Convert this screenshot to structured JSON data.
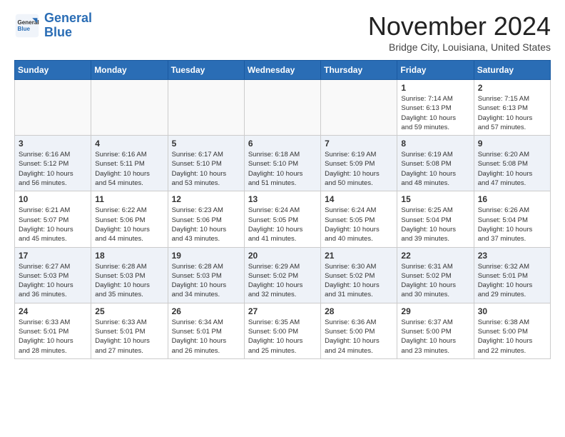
{
  "header": {
    "logo_line1": "General",
    "logo_line2": "Blue",
    "month": "November 2024",
    "location": "Bridge City, Louisiana, United States"
  },
  "days_of_week": [
    "Sunday",
    "Monday",
    "Tuesday",
    "Wednesday",
    "Thursday",
    "Friday",
    "Saturday"
  ],
  "weeks": [
    [
      {
        "day": "",
        "info": ""
      },
      {
        "day": "",
        "info": ""
      },
      {
        "day": "",
        "info": ""
      },
      {
        "day": "",
        "info": ""
      },
      {
        "day": "",
        "info": ""
      },
      {
        "day": "1",
        "info": "Sunrise: 7:14 AM\nSunset: 6:13 PM\nDaylight: 10 hours\nand 59 minutes."
      },
      {
        "day": "2",
        "info": "Sunrise: 7:15 AM\nSunset: 6:13 PM\nDaylight: 10 hours\nand 57 minutes."
      }
    ],
    [
      {
        "day": "3",
        "info": "Sunrise: 6:16 AM\nSunset: 5:12 PM\nDaylight: 10 hours\nand 56 minutes."
      },
      {
        "day": "4",
        "info": "Sunrise: 6:16 AM\nSunset: 5:11 PM\nDaylight: 10 hours\nand 54 minutes."
      },
      {
        "day": "5",
        "info": "Sunrise: 6:17 AM\nSunset: 5:10 PM\nDaylight: 10 hours\nand 53 minutes."
      },
      {
        "day": "6",
        "info": "Sunrise: 6:18 AM\nSunset: 5:10 PM\nDaylight: 10 hours\nand 51 minutes."
      },
      {
        "day": "7",
        "info": "Sunrise: 6:19 AM\nSunset: 5:09 PM\nDaylight: 10 hours\nand 50 minutes."
      },
      {
        "day": "8",
        "info": "Sunrise: 6:19 AM\nSunset: 5:08 PM\nDaylight: 10 hours\nand 48 minutes."
      },
      {
        "day": "9",
        "info": "Sunrise: 6:20 AM\nSunset: 5:08 PM\nDaylight: 10 hours\nand 47 minutes."
      }
    ],
    [
      {
        "day": "10",
        "info": "Sunrise: 6:21 AM\nSunset: 5:07 PM\nDaylight: 10 hours\nand 45 minutes."
      },
      {
        "day": "11",
        "info": "Sunrise: 6:22 AM\nSunset: 5:06 PM\nDaylight: 10 hours\nand 44 minutes."
      },
      {
        "day": "12",
        "info": "Sunrise: 6:23 AM\nSunset: 5:06 PM\nDaylight: 10 hours\nand 43 minutes."
      },
      {
        "day": "13",
        "info": "Sunrise: 6:24 AM\nSunset: 5:05 PM\nDaylight: 10 hours\nand 41 minutes."
      },
      {
        "day": "14",
        "info": "Sunrise: 6:24 AM\nSunset: 5:05 PM\nDaylight: 10 hours\nand 40 minutes."
      },
      {
        "day": "15",
        "info": "Sunrise: 6:25 AM\nSunset: 5:04 PM\nDaylight: 10 hours\nand 39 minutes."
      },
      {
        "day": "16",
        "info": "Sunrise: 6:26 AM\nSunset: 5:04 PM\nDaylight: 10 hours\nand 37 minutes."
      }
    ],
    [
      {
        "day": "17",
        "info": "Sunrise: 6:27 AM\nSunset: 5:03 PM\nDaylight: 10 hours\nand 36 minutes."
      },
      {
        "day": "18",
        "info": "Sunrise: 6:28 AM\nSunset: 5:03 PM\nDaylight: 10 hours\nand 35 minutes."
      },
      {
        "day": "19",
        "info": "Sunrise: 6:28 AM\nSunset: 5:03 PM\nDaylight: 10 hours\nand 34 minutes."
      },
      {
        "day": "20",
        "info": "Sunrise: 6:29 AM\nSunset: 5:02 PM\nDaylight: 10 hours\nand 32 minutes."
      },
      {
        "day": "21",
        "info": "Sunrise: 6:30 AM\nSunset: 5:02 PM\nDaylight: 10 hours\nand 31 minutes."
      },
      {
        "day": "22",
        "info": "Sunrise: 6:31 AM\nSunset: 5:02 PM\nDaylight: 10 hours\nand 30 minutes."
      },
      {
        "day": "23",
        "info": "Sunrise: 6:32 AM\nSunset: 5:01 PM\nDaylight: 10 hours\nand 29 minutes."
      }
    ],
    [
      {
        "day": "24",
        "info": "Sunrise: 6:33 AM\nSunset: 5:01 PM\nDaylight: 10 hours\nand 28 minutes."
      },
      {
        "day": "25",
        "info": "Sunrise: 6:33 AM\nSunset: 5:01 PM\nDaylight: 10 hours\nand 27 minutes."
      },
      {
        "day": "26",
        "info": "Sunrise: 6:34 AM\nSunset: 5:01 PM\nDaylight: 10 hours\nand 26 minutes."
      },
      {
        "day": "27",
        "info": "Sunrise: 6:35 AM\nSunset: 5:00 PM\nDaylight: 10 hours\nand 25 minutes."
      },
      {
        "day": "28",
        "info": "Sunrise: 6:36 AM\nSunset: 5:00 PM\nDaylight: 10 hours\nand 24 minutes."
      },
      {
        "day": "29",
        "info": "Sunrise: 6:37 AM\nSunset: 5:00 PM\nDaylight: 10 hours\nand 23 minutes."
      },
      {
        "day": "30",
        "info": "Sunrise: 6:38 AM\nSunset: 5:00 PM\nDaylight: 10 hours\nand 22 minutes."
      }
    ]
  ]
}
